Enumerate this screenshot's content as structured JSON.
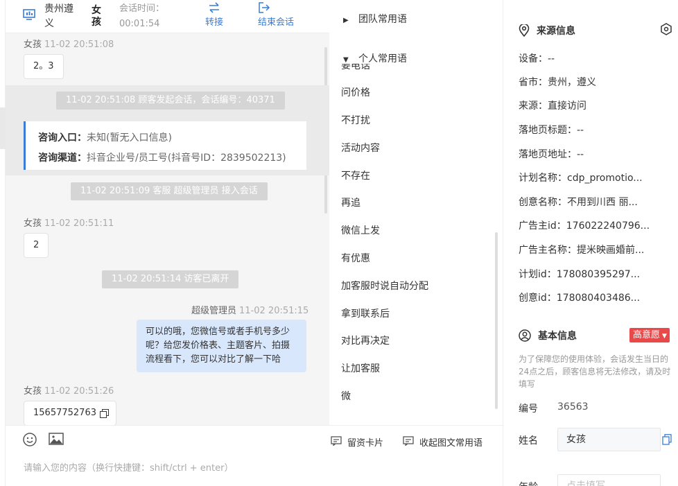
{
  "header": {
    "location": "贵州遵义",
    "visitor_name": "女孩",
    "session_time_label": "会话时间：",
    "session_time": "00:01:54",
    "transfer_label": "转接",
    "end_label": "结束会话"
  },
  "messages": {
    "m1_who": "女孩",
    "m1_time": "11-02 20:51:08",
    "m1_text": "2。3",
    "sys1": "11-02 20:51:08 顾客发起会话，会话编号：40371",
    "entry_label": "咨询入口：",
    "entry_value": "未知(暂无入口信息)",
    "channel_label": "咨询渠道：",
    "channel_value": "抖音企业号/员工号(抖音号ID：2839502213)",
    "sys2": "11-02 20:51:09 客服 超级管理员 接入会话",
    "m2_who": "女孩",
    "m2_time": "11-02 20:51:11",
    "m2_text": "2",
    "sys3": "11-02 20:51:14 访客已离开",
    "m3_who": "超级管理员",
    "m3_time": "11-02 20:51:15",
    "m3_text": "可以的哦，您微信号或者手机号多少呢？给您发价格表、主题客片、拍摄流程看下，您可以对比了解一下哈",
    "m4_who": "女孩",
    "m4_time": "11-02 20:51:26",
    "m4_text": "15657752763"
  },
  "input": {
    "placeholder": "请输入您的内容（换行快捷键：shift/ctrl + enter）"
  },
  "phrases": {
    "team_label": "团队常用语",
    "personal_label": "个人常用语",
    "partial_item": "要电话",
    "items": [
      "问价格",
      "不打扰",
      "活动内容",
      "不存在",
      "再追",
      "微信上发",
      "有优惠",
      "加客服时说自动分配",
      "拿到联系后",
      "对比再决定",
      "让加客服",
      "微"
    ],
    "card_btn": "留资卡片",
    "collapse_btn": "收起图文常用语"
  },
  "source_info": {
    "title": "来源信息",
    "rows": [
      "设备：--",
      "省市：贵州，遵义",
      "来源：直接访问",
      "落地页标题：--",
      "落地页地址：--",
      "计划名称：cdp_promotio...",
      "创意名称：不用到川西 丽...",
      "广告主id：176022240796...",
      "广告主名称：提米映画婚前...",
      "计划id：178080395297...",
      "创意id：178080403486..."
    ]
  },
  "basic_info": {
    "title": "基本信息",
    "intent_badge": "高意愿",
    "notice": "为了保障您的使用体验，会话发生当日的24点之后，顾客信息将无法修改，请及时填写",
    "id_label": "编号",
    "id_value": "36563",
    "name_label": "姓名",
    "name_value": "女孩",
    "age_label": "年龄",
    "age_placeholder": "点击填写"
  }
}
